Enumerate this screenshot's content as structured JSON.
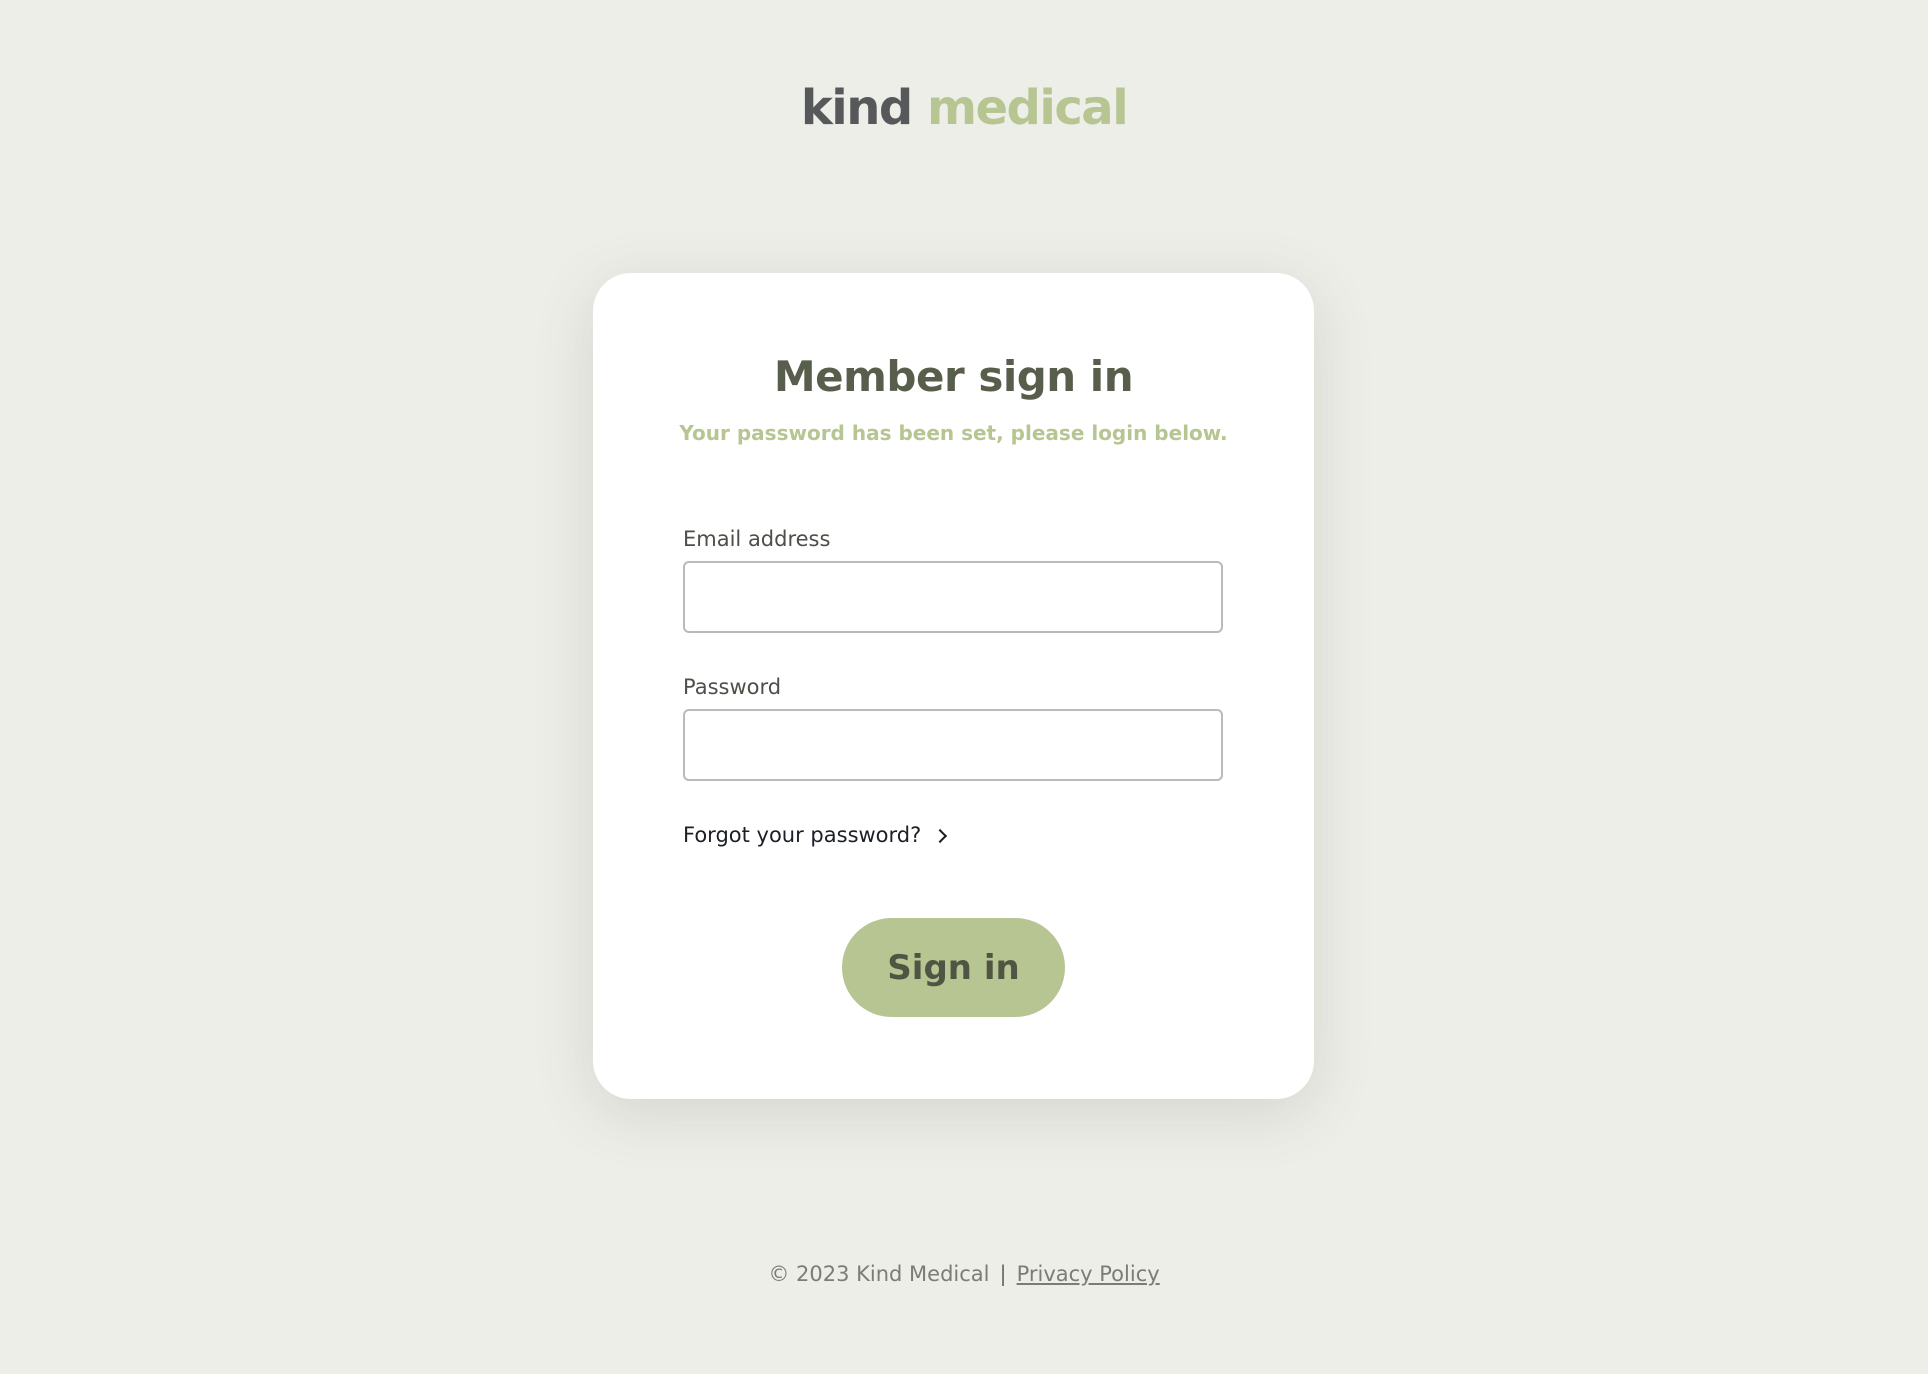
{
  "brand": {
    "word1": "kind",
    "word2": "medical"
  },
  "signin": {
    "title": "Member sign in",
    "message": "Your password has been set, please login below.",
    "email_label": "Email address",
    "email_value": "",
    "password_label": "Password",
    "password_value": "",
    "forgot_label": "Forgot your password?",
    "submit_label": "Sign in"
  },
  "footer": {
    "copyright": "© 2023 Kind Medical",
    "separator": "|",
    "privacy_label": "Privacy Policy"
  },
  "colors": {
    "background": "#edeee8",
    "accent": "#b6c591",
    "heading": "#585e4c",
    "logo_dark": "#56585a"
  },
  "icons": {
    "forgot_link_icon": "chevron-right-icon"
  }
}
